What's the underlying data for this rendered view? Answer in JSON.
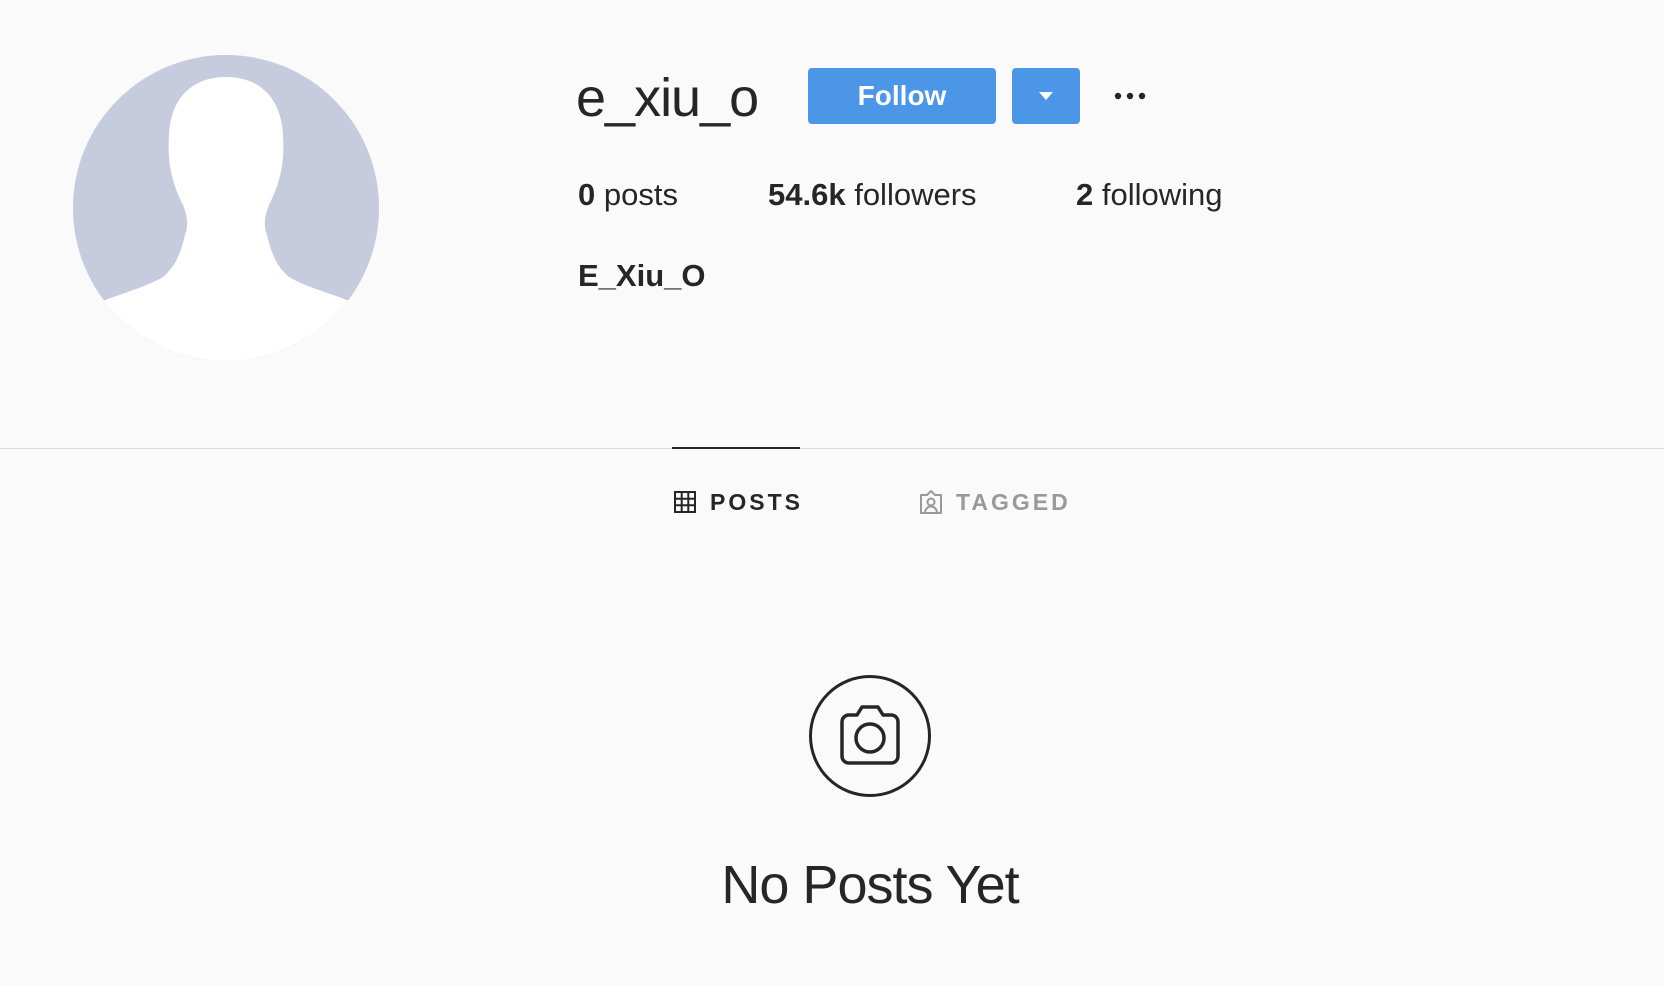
{
  "profile": {
    "username": "e_xiu_o",
    "full_name": "E_Xiu_O"
  },
  "actions": {
    "follow_label": "Follow",
    "dropdown_icon": "triangle-down-icon",
    "more_icon": "ellipsis-icon"
  },
  "stats": {
    "posts_count": "0",
    "posts_label": "posts",
    "followers_count": "54.6k",
    "followers_label": "followers",
    "following_count": "2",
    "following_label": "following"
  },
  "tabs": [
    {
      "label": "POSTS",
      "icon": "grid-icon",
      "active": true
    },
    {
      "label": "TAGGED",
      "icon": "tagged-person-icon",
      "active": false
    }
  ],
  "empty_state": {
    "icon": "camera-icon",
    "title": "No Posts Yet"
  },
  "colors": {
    "accent": "#4b96e6",
    "background": "#fafafa",
    "text": "#262626",
    "muted": "#999999",
    "avatar_bg": "#c7cbde"
  }
}
